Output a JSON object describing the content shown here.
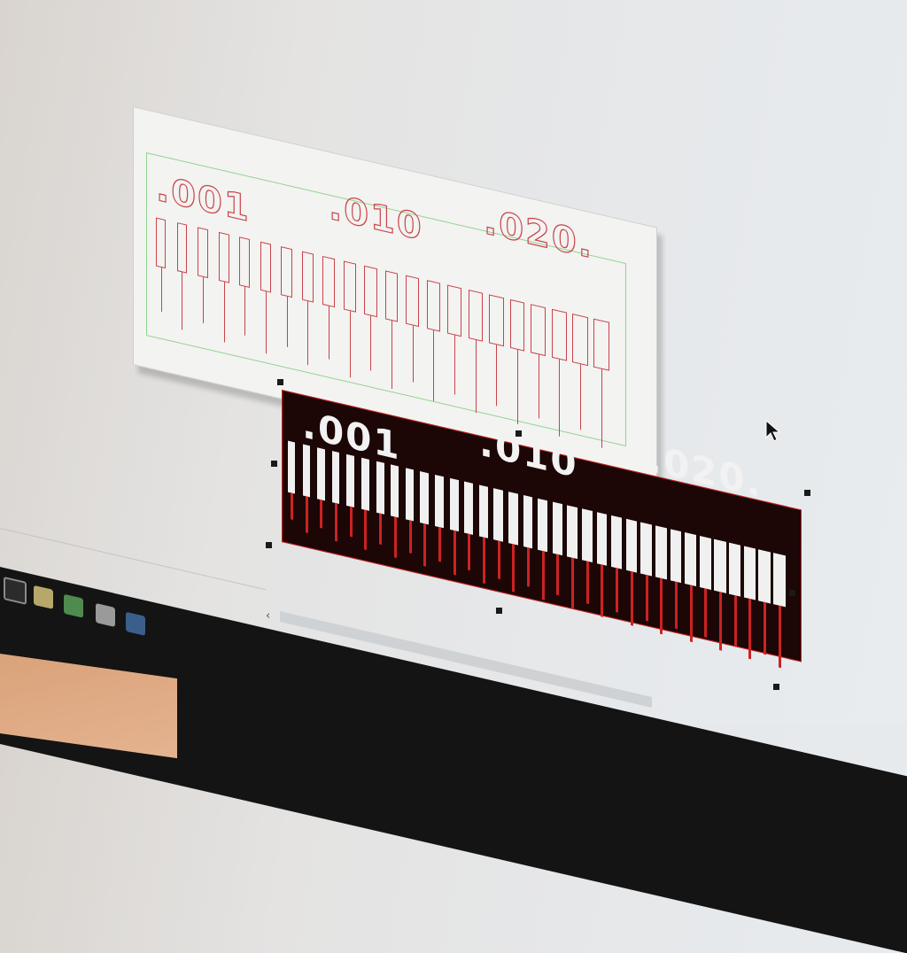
{
  "drawing": {
    "labels": [
      ".001",
      ".010",
      ".020."
    ]
  },
  "icons": {
    "window": "window-icon",
    "folder": "folder-icon",
    "app": "app-icon",
    "calculator": "calculator-icon",
    "inkscape": "inkscape-icon",
    "cursor": "mouse-pointer-icon"
  },
  "colors": {
    "outline_stroke": "#c8434a",
    "page_border": "#8fd48f",
    "selection_fill": "#1c0606",
    "selection_stroke": "#d02020"
  }
}
